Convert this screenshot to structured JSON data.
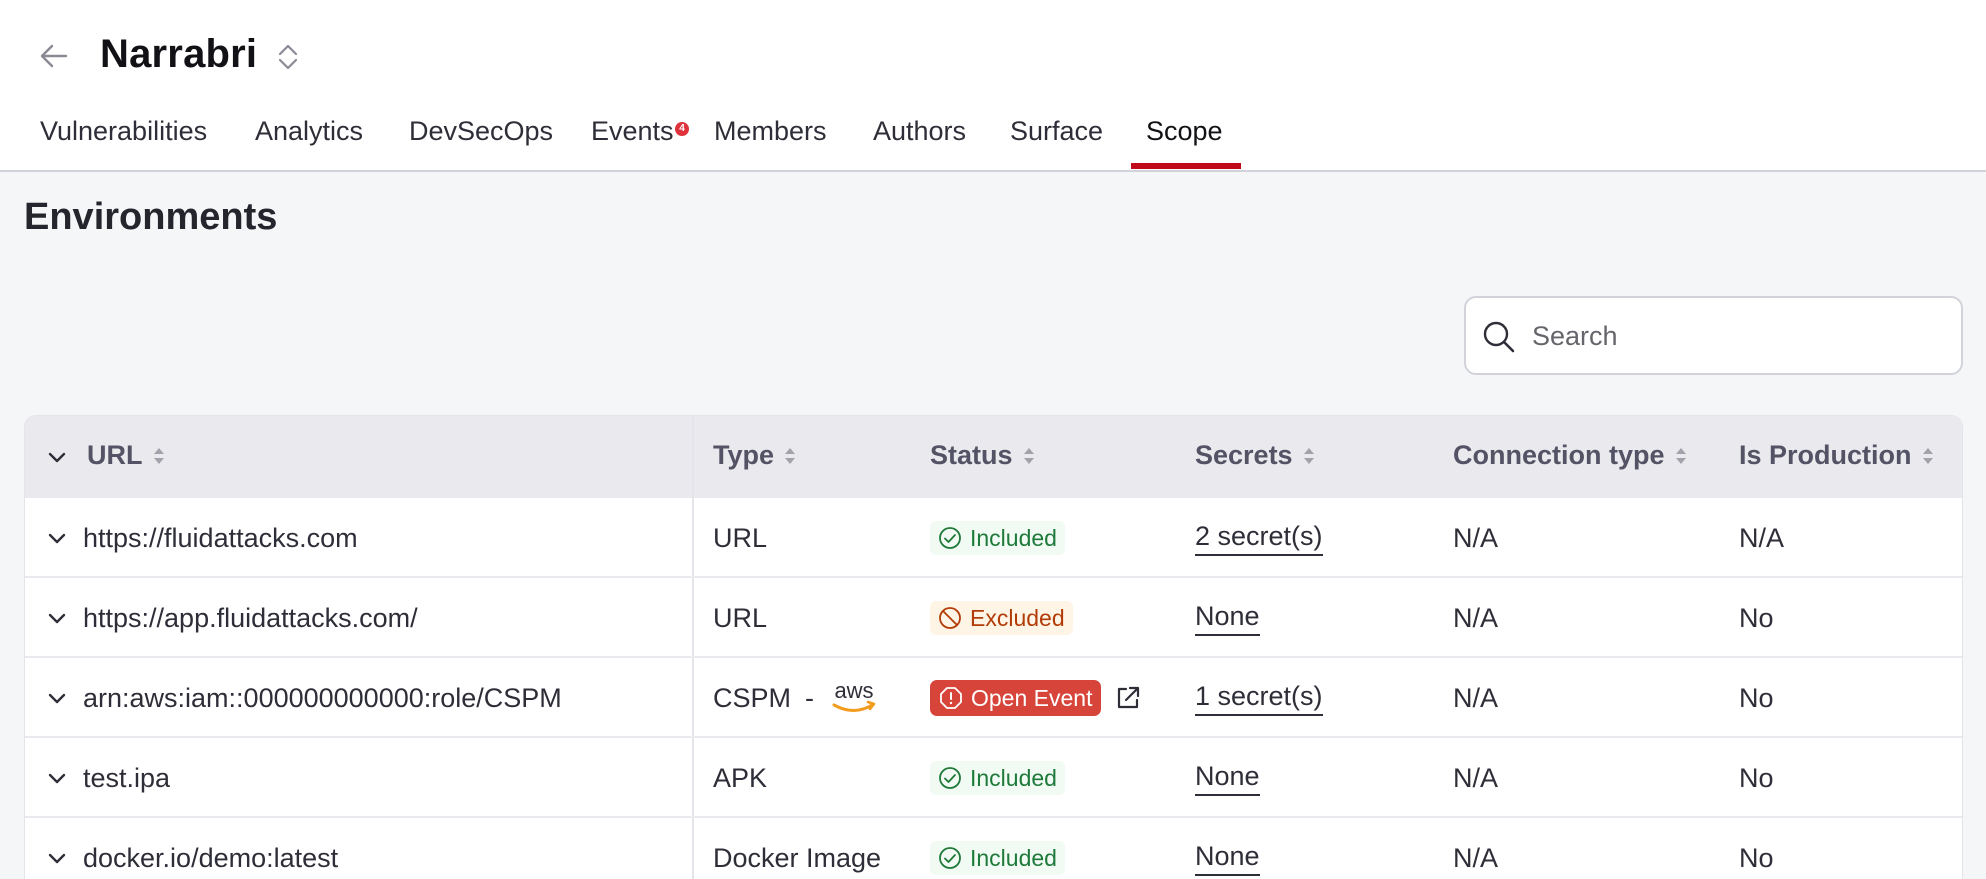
{
  "header": {
    "title": "Narrabri"
  },
  "tabs": [
    {
      "label": "Vulnerabilities"
    },
    {
      "label": "Analytics"
    },
    {
      "label": "DevSecOps"
    },
    {
      "label": "Events",
      "badge": "4"
    },
    {
      "label": "Members"
    },
    {
      "label": "Authors"
    },
    {
      "label": "Surface"
    },
    {
      "label": "Scope",
      "active": true
    }
  ],
  "section": {
    "heading": "Environments"
  },
  "search": {
    "placeholder": "Search"
  },
  "table": {
    "columns": [
      "URL",
      "Type",
      "Status",
      "Secrets",
      "Connection type",
      "Is Production"
    ],
    "rows": [
      {
        "url": "https://fluidattacks.com",
        "type": "URL",
        "status": "Included",
        "secrets": "2 secret(s)",
        "connection_type": "N/A",
        "is_production": "N/A"
      },
      {
        "url": "https://app.fluidattacks.com/",
        "type": "URL",
        "status": "Excluded",
        "secrets": "None",
        "connection_type": "N/A",
        "is_production": "No"
      },
      {
        "url": "arn:aws:iam::000000000000:role/CSPM",
        "type": "CSPM",
        "type_separator": "-",
        "type_logo": "aws",
        "status": "Open Event",
        "secrets": "1 secret(s)",
        "connection_type": "N/A",
        "is_production": "No"
      },
      {
        "url": "test.ipa",
        "type": "APK",
        "status": "Included",
        "secrets": "None",
        "connection_type": "N/A",
        "is_production": "No"
      },
      {
        "url": "docker.io/demo:latest",
        "type": "Docker Image",
        "status": "Included",
        "secrets": "None",
        "connection_type": "N/A",
        "is_production": "No"
      }
    ]
  },
  "colors": {
    "accent": "#bf0b1a",
    "included": "#1f7a3a",
    "excluded": "#b23c07",
    "event": "#d7443a",
    "aws": "#f39c1e"
  }
}
